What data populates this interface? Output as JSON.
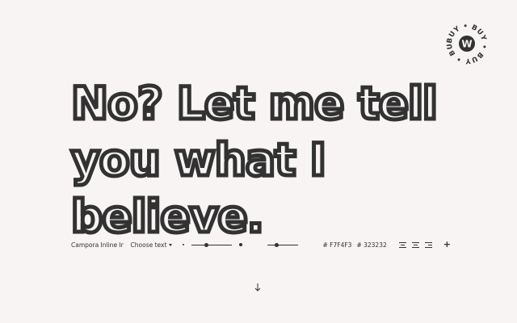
{
  "badge": {
    "ring_text": "BUY • BUY • BUY • BUY • ",
    "center_letter": "W"
  },
  "specimen": {
    "text": "No? Let me tell you what I believe."
  },
  "toolbar": {
    "font_name": "Campora Inline Inl...",
    "choose_text_label": "Choose text",
    "size_slider_value": 0.36,
    "line_height_slider_value": 0.3,
    "background_color": "#F7F4F3",
    "text_color": "#323232",
    "background_color_label": "# F7F4F3",
    "text_color_label": "# 323232",
    "add_label": "+"
  },
  "scroll_icon": "arrow-down-icon"
}
